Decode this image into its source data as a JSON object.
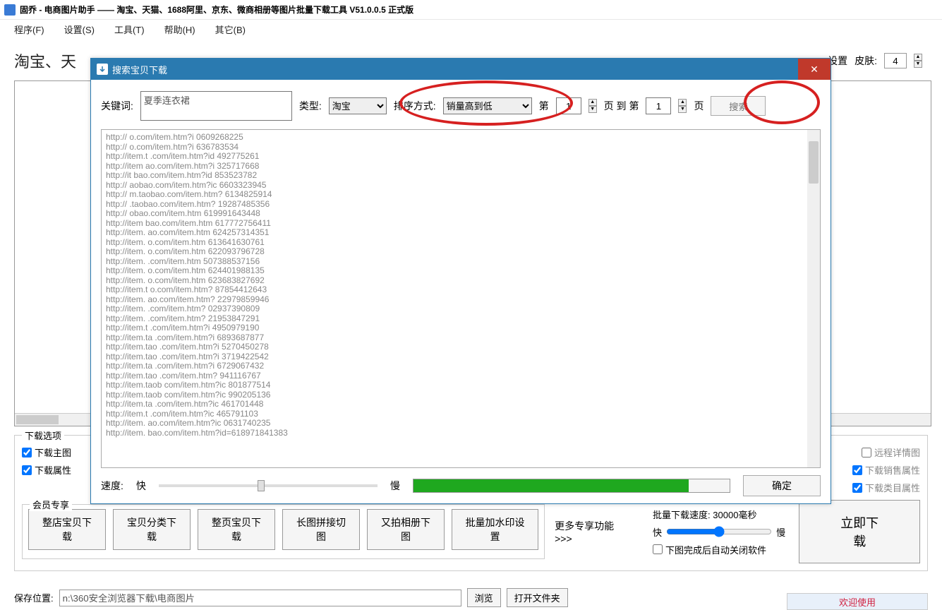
{
  "title_bar": "固乔 - 电商图片助手 —— 淘宝、天猫、1688阿里、京东、微商相册等图片批量下载工具 V51.0.0.5 正式版",
  "menu": {
    "program": "程序(F)",
    "settings": "设置(S)",
    "tools": "工具(T)",
    "help": "帮助(H)",
    "other": "其它(B)"
  },
  "heading_partial": "淘宝、天",
  "right": {
    "settings": "设置",
    "skin": "皮肤:",
    "skin_value": "4"
  },
  "options": {
    "legend": "下载选项",
    "dl_main": "下载主图",
    "dl_attr": "下载属性",
    "remote_detail": "远程详情图",
    "dl_sale_attr": "下载销售属性",
    "dl_cat_attr": "下载类目属性"
  },
  "member": {
    "legend": "会员专享",
    "b1": "整店宝贝下载",
    "b2": "宝贝分类下载",
    "b3": "整页宝贝下载",
    "b4": "长图拼接切图",
    "b5": "又拍相册下图",
    "b6": "批量加水印设置",
    "more": "更多专享功能>>>"
  },
  "bulk": {
    "speed_label": "批量下载速度:",
    "speed_value": "30000毫秒",
    "fast": "快",
    "slow": "慢",
    "auto_close": "下图完成后自动关闭软件",
    "download_now": "立即下载"
  },
  "save": {
    "label": "保存位置:",
    "path": "n:\\360安全浏览器下载\\电商图片",
    "browse": "浏览",
    "open": "打开文件夹"
  },
  "footer": "欢迎使用",
  "dialog": {
    "title": "搜索宝贝下载",
    "keyword_label": "关键词:",
    "keyword_value": "夏季连衣裙",
    "type_label": "类型:",
    "type_value": "淘宝",
    "sort_label": "排序方式:",
    "sort_value": "销量高到低",
    "page_prefix": "第",
    "page_from": "1",
    "page_mid": "页 到 第",
    "page_to": "1",
    "page_suffix": "页",
    "search": "搜索",
    "urls": [
      "http://      o.com/item.htm?i    0609268225",
      "http://      o.com/item.htm?i    636783534",
      "http://item.t   .com/item.htm?id   492775261",
      "http://item     ao.com/item.htm?i   325717668",
      "http://it      bao.com/item.htm?id   853523782",
      "http://    aobao.com/item.htm?ic    6603323945",
      "http://    m.taobao.com/item.htm?    6134825914",
      "http://     .taobao.com/item.htm?    19287485356",
      "http://        obao.com/item.htm     619991643448",
      "http://item    bao.com/item.htm     617772756411",
      "http://item.    ao.com/item.htm     624257314351",
      "http://item.     o.com/item.htm     613641630761",
      "http://item.     o.com/item.htm     622093796728",
      "http://item.      .com/item.htm     507388537156",
      "http://item.     o.com/item.htm     624401988135",
      "http://item.     o.com/item.htm     623683827692",
      "http://item.t    o.com/item.htm?    87854412643",
      "http://item.     ao.com/item.htm?    22979859946",
      "http://item.      .com/item.htm?    02937390809",
      "http://item.      .com/item.htm?    21953847291",
      "http://item.t    .com/item.htm?i    4950979190",
      "http://item.ta    .com/item.htm?i    6893687877",
      "http://item.tao   .com/item.htm?i    5270450278",
      "http://item.tao   .com/item.htm?i    3719422542",
      "http://item.ta    .com/item.htm?i    6729067432",
      "http://item.tao   .com/item.htm?     941116767",
      "http://item.taob   com/item.htm?ic    801877514",
      "http://item.taob   com/item.htm?ic    990205136",
      "http://item.ta    .com/item.htm?ic    461701448",
      "http://item.t     .com/item.htm?ic    465791103",
      "http://item.      ao.com/item.htm?ic    0631740235",
      "http://item.   bao.com/item.htm?id=618971841383"
    ],
    "speed": "速度:",
    "fast": "快",
    "slow": "慢",
    "ok": "确定"
  }
}
